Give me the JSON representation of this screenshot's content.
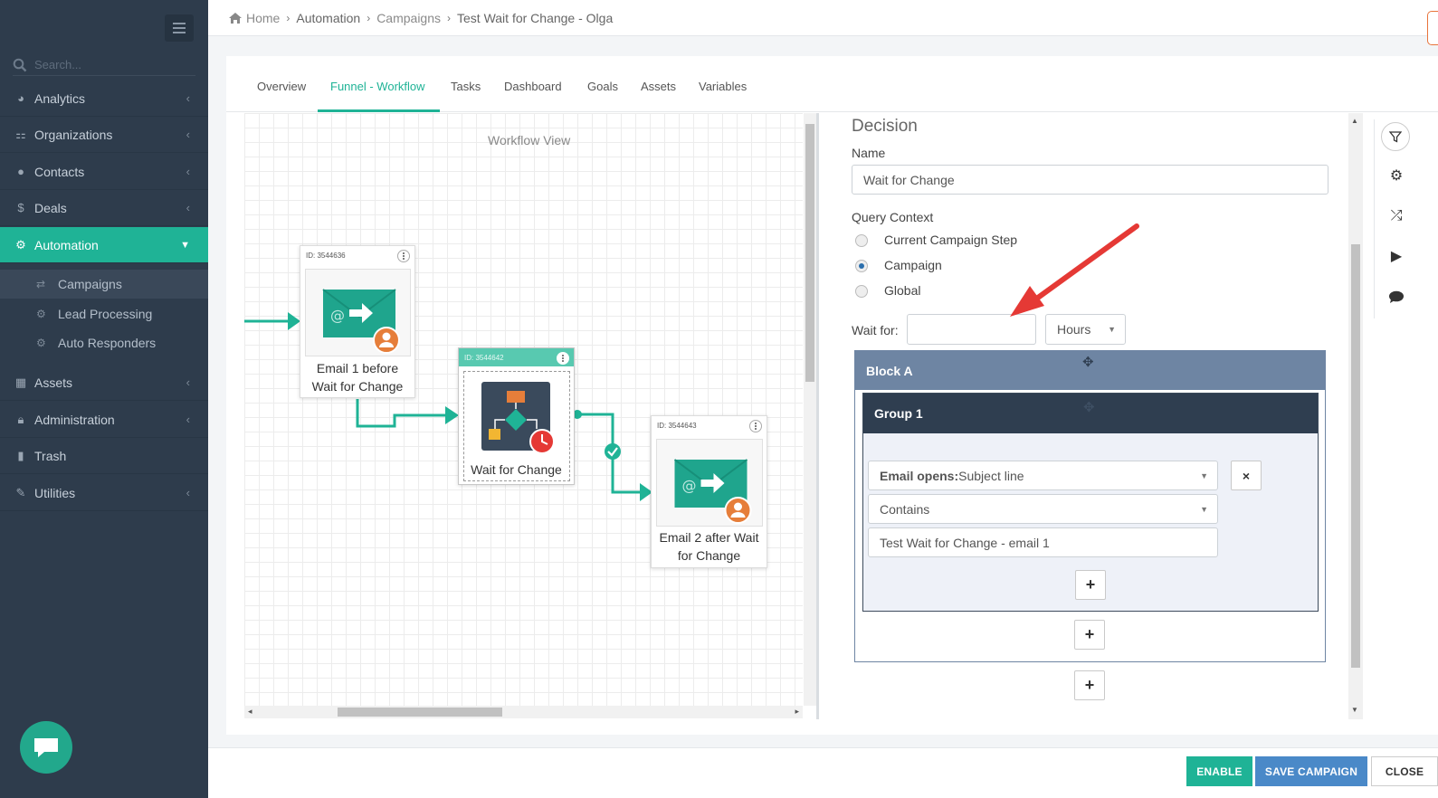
{
  "sidebar": {
    "search_placeholder": "Search...",
    "items": [
      {
        "label": "Analytics",
        "icon": "dashboard-icon"
      },
      {
        "label": "Organizations",
        "icon": "sitemap-icon"
      },
      {
        "label": "Contacts",
        "icon": "users-icon"
      },
      {
        "label": "Deals",
        "icon": "dollar-icon"
      },
      {
        "label": "Automation",
        "icon": "cogs-icon"
      },
      {
        "label": "Assets",
        "icon": "grid-icon"
      },
      {
        "label": "Administration",
        "icon": "lock-icon"
      },
      {
        "label": "Trash",
        "icon": "trash-icon"
      },
      {
        "label": "Utilities",
        "icon": "wrench-icon"
      }
    ],
    "subitems": [
      "Campaigns",
      "Lead Processing",
      "Auto Responders"
    ]
  },
  "breadcrumb": {
    "home": "Home",
    "automation": "Automation",
    "campaigns": "Campaigns",
    "current": "Test Wait for Change - Olga"
  },
  "tabs": [
    "Overview",
    "Funnel - Workflow",
    "Tasks",
    "Dashboard",
    "Goals",
    "Assets",
    "Variables"
  ],
  "workflow": {
    "title": "Workflow View",
    "nodes": [
      {
        "id": "ID: 3544636",
        "label_line1": "Email 1 before",
        "label_line2": "Wait for Change"
      },
      {
        "id": "ID: 3544642",
        "label_line1": "Wait for Change"
      },
      {
        "id": "ID: 3544643",
        "label_line1": "Email 2 after Wait",
        "label_line2": "for Change"
      }
    ]
  },
  "decision": {
    "title": "Decision",
    "name_label": "Name",
    "name_value": "Wait for Change",
    "query_label": "Query Context",
    "options": [
      "Current Campaign Step",
      "Campaign",
      "Global"
    ],
    "selected_option": "Campaign",
    "wait_label": "Wait for:",
    "wait_value": "",
    "wait_unit": "Hours",
    "block_title": "Block A",
    "group_title": "Group 1",
    "condition_bold": "Email opens:",
    "condition_rest": " Subject line",
    "operator": "Contains",
    "condition_value": "Test Wait for Change - email 1",
    "plus": "+",
    "remove": "×"
  },
  "footer": {
    "enable": "ENABLE",
    "save": "SAVE CAMPAIGN",
    "close": "CLOSE"
  },
  "colors": {
    "accent": "#1fb396",
    "sidebar": "#2e3c4c",
    "block_header": "#6e85a3",
    "group_header": "#2f3e50",
    "save_button": "#4a89c8",
    "arrow": "#e53935"
  }
}
